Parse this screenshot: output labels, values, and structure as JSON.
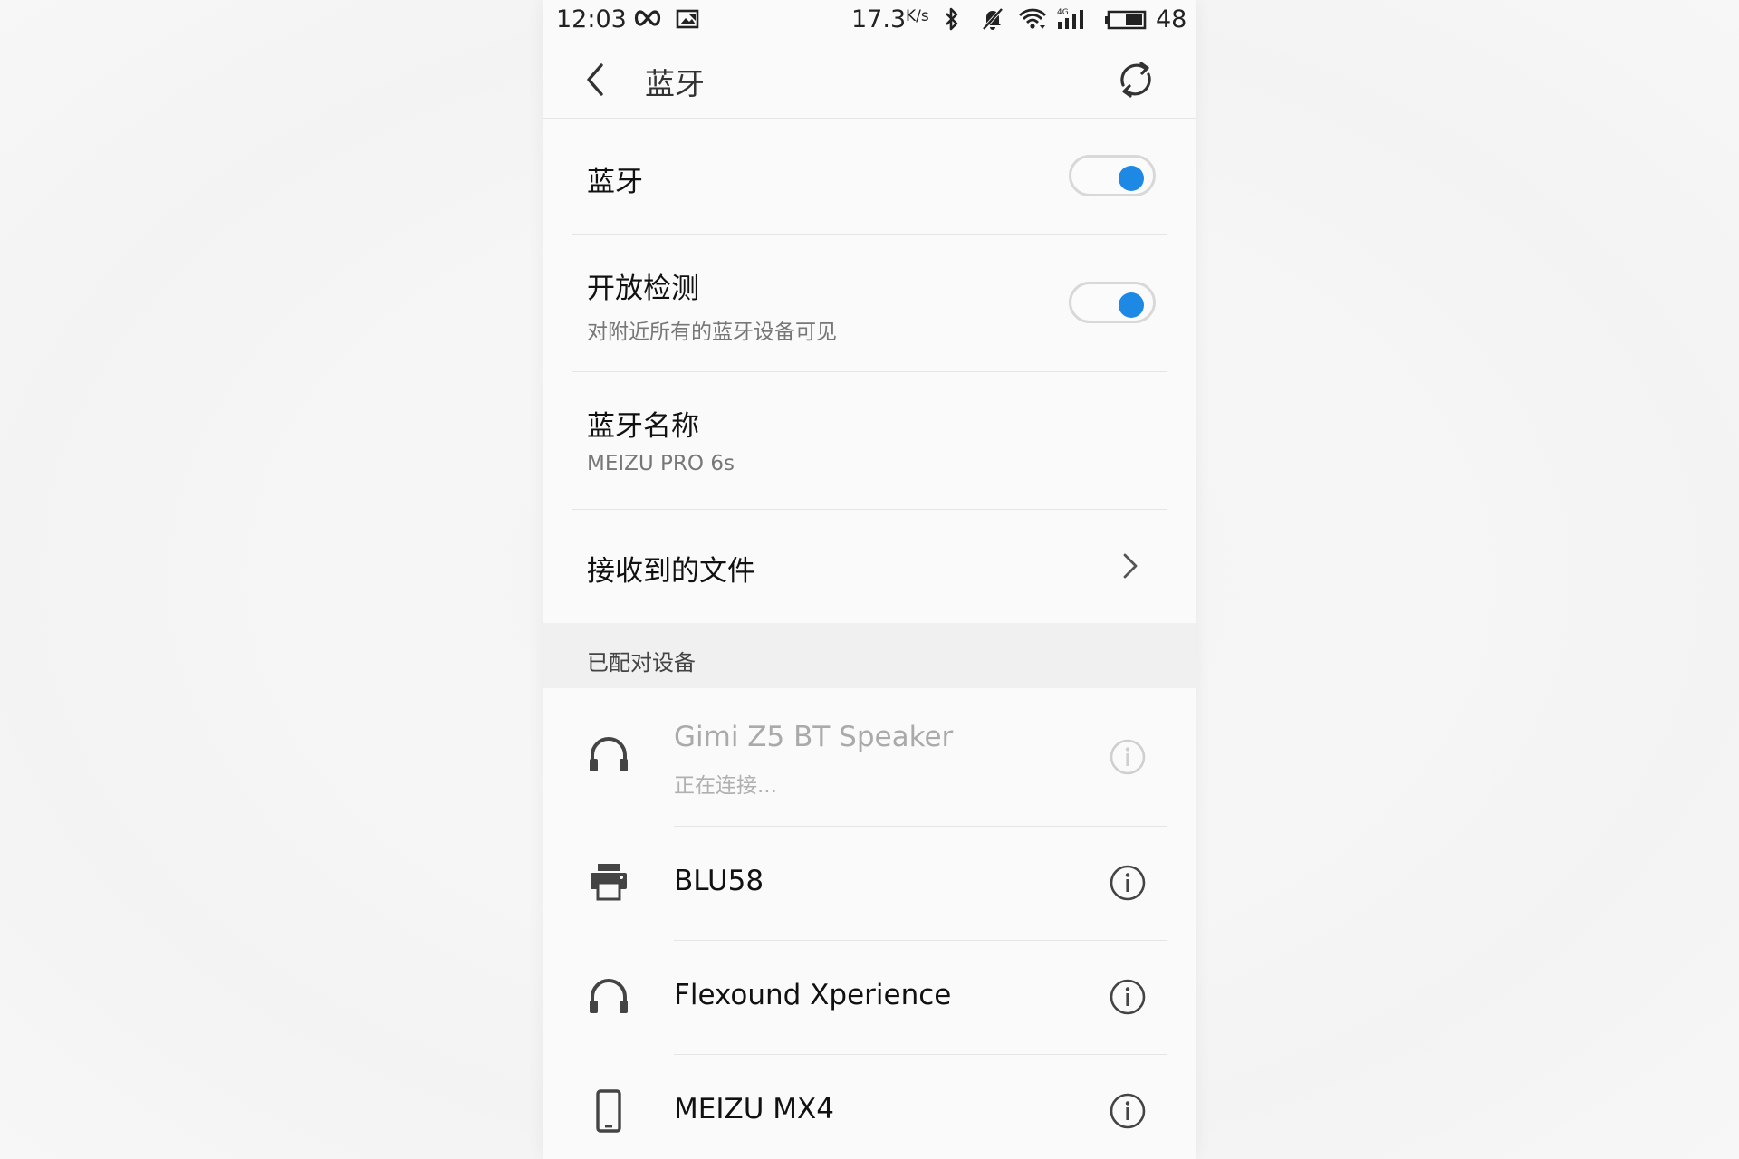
{
  "status_bar": {
    "time": "12:03",
    "speed": "17.3",
    "speed_unit": "K/s",
    "battery": "48",
    "icons": [
      "infinity-icon",
      "image-icon",
      "bluetooth-icon",
      "mute-icon",
      "wifi-icon",
      "signal-4g-icon",
      "battery-icon"
    ],
    "signal_label": "4G"
  },
  "header": {
    "title": "蓝牙",
    "back_icon": "back-arrow-icon",
    "refresh_icon": "refresh-icon"
  },
  "settings": {
    "bluetooth": {
      "title": "蓝牙",
      "enabled": true
    },
    "discoverable": {
      "title": "开放检测",
      "subtitle": "对附近所有的蓝牙设备可见",
      "enabled": true
    },
    "device_name": {
      "title": "蓝牙名称",
      "value": "MEIZU PRO 6s"
    },
    "received_files": {
      "title": "接收到的文件"
    }
  },
  "paired_section": {
    "title": "已配对设备",
    "devices": [
      {
        "name": "Gimi Z5 BT Speaker",
        "status": "正在连接...",
        "icon": "headphones-icon",
        "dimmed": true
      },
      {
        "name": "BLU58",
        "status": "",
        "icon": "printer-icon",
        "dimmed": false
      },
      {
        "name": "Flexound Xperience",
        "status": "",
        "icon": "headphones-icon",
        "dimmed": false
      },
      {
        "name": "MEIZU MX4",
        "status": "",
        "icon": "phone-icon",
        "dimmed": false
      }
    ]
  },
  "colors": {
    "accent": "#1e88e5",
    "background": "#fafafa",
    "section_bg": "#f0f0f0"
  }
}
